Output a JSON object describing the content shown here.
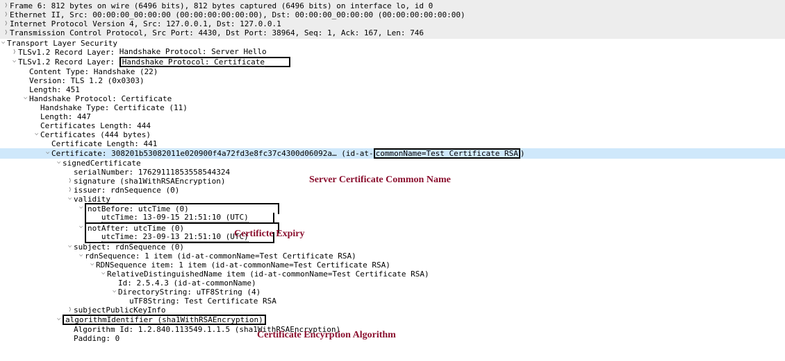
{
  "frame": {
    "summary": "Frame 6: 812 bytes on wire (6496 bits), 812 bytes captured (6496 bits) on interface lo, id 0",
    "eth": "Ethernet II, Src: 00:00:00_00:00:00 (00:00:00:00:00:00), Dst: 00:00:00_00:00:00 (00:00:00:00:00:00)",
    "ip": "Internet Protocol Version 4, Src: 127.0.0.1, Dst: 127.0.0.1",
    "tcp": "Transmission Control Protocol, Src Port: 4430, Dst Port: 38964, Seq: 1, Ack: 167, Len: 746"
  },
  "tls": {
    "label": "Transport Layer Security",
    "rec1_prefix": "TLSv1.2 Record Layer: ",
    "rec1_link": "Handshake Protocol: Server Hello",
    "rec2_prefix": "TLSv1.2 Record Layer: ",
    "rec2_box": "Handshake Protocol: Certificate",
    "contentType": "Content Type: Handshake (22)",
    "version": "Version: TLS 1.2 (0x0303)",
    "length": "Length: 451",
    "handshake": {
      "label": "Handshake Protocol: Certificate",
      "type": "Handshake Type: Certificate (11)",
      "length": "Length: 447",
      "certsLength": "Certificates Length: 444",
      "certs": {
        "label": "Certificates (444 bytes)",
        "certLength": "Certificate Length: 441",
        "cert_prefix": "Certificate: 308201b53082011e020900f4a72fd3e8fc37c4300d06092a… (id-at-",
        "cert_cn_box": "commonName=Test Certificate RSA",
        "cert_suffix": ")",
        "signed": {
          "label": "signedCertificate",
          "serial": "serialNumber: 17629111853558544324",
          "signature": "signature (sha1WithRSAEncryption)",
          "issuer": "issuer: rdnSequence (0)",
          "validity": {
            "label": "validity",
            "notBefore": "notBefore: utcTime (0)",
            "notBefore_utc": "utcTime: 13-09-15 21:51:10 (UTC)",
            "notAfter": "notAfter: utcTime (0)",
            "notAfter_utc": "utcTime: 23-09-13 21:51:10 (UTC)"
          },
          "subject": "subject: rdnSequence (0)",
          "rdnSeq": "rdnSequence: 1 item (id-at-commonName=Test Certificate RSA)",
          "rdnItem": "RDNSequence item: 1 item (id-at-commonName=Test Certificate RSA)",
          "rdn_rel": "RelativeDistinguishedName item (id-at-commonName=Test Certificate RSA)",
          "rdn_id": "Id: 2.5.4.3 (id-at-commonName)",
          "dirString": "DirectoryString: uTF8String (4)",
          "utf8": "uTF8String: Test Certificate RSA",
          "spki": "subjectPublicKeyInfo"
        },
        "algId_box": "algorithmIdentifier (sha1WithRSAEncryption)",
        "algId_inner": "Algorithm Id: 1.2.840.113549.1.1.5 (sha1WithRSAEncryption)",
        "padding": "Padding: 0"
      }
    }
  },
  "annotations": {
    "commonName": "Server Certificate Common Name",
    "expiry": "Certificte Expiry",
    "algorithm": "Certificate Encyrption Algorithm"
  }
}
